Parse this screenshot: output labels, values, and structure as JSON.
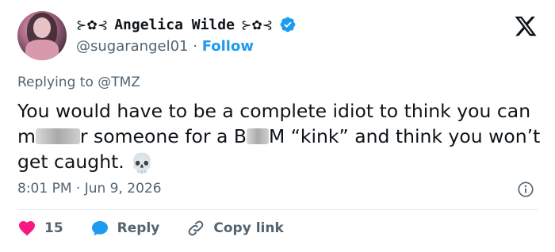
{
  "author": {
    "display_name": "Angelica Wilde",
    "decoration_left": "⊱✿⊰",
    "decoration_right": "⊱✿⊰",
    "handle": "@sugarangel01",
    "separator": "·",
    "follow_label": "Follow",
    "verified_icon": "verified-badge-icon",
    "brand_color": "#1d9bf0"
  },
  "reply_context": {
    "label": "Replying to",
    "target": "@TMZ"
  },
  "tweet": {
    "segment1": "You would have to be a complete idiot to think you can m",
    "segment2": "r someone for a B",
    "segment3": "M “kink” and think you won’t get caught.",
    "emoji": "💀"
  },
  "meta": {
    "time": "8:01 PM",
    "separator": "·",
    "date": "Jun 9, 2026"
  },
  "actions": {
    "like_count": "15",
    "reply_label": "Reply",
    "copy_label": "Copy link",
    "like_color": "#f91880",
    "reply_color": "#1d9bf0"
  }
}
